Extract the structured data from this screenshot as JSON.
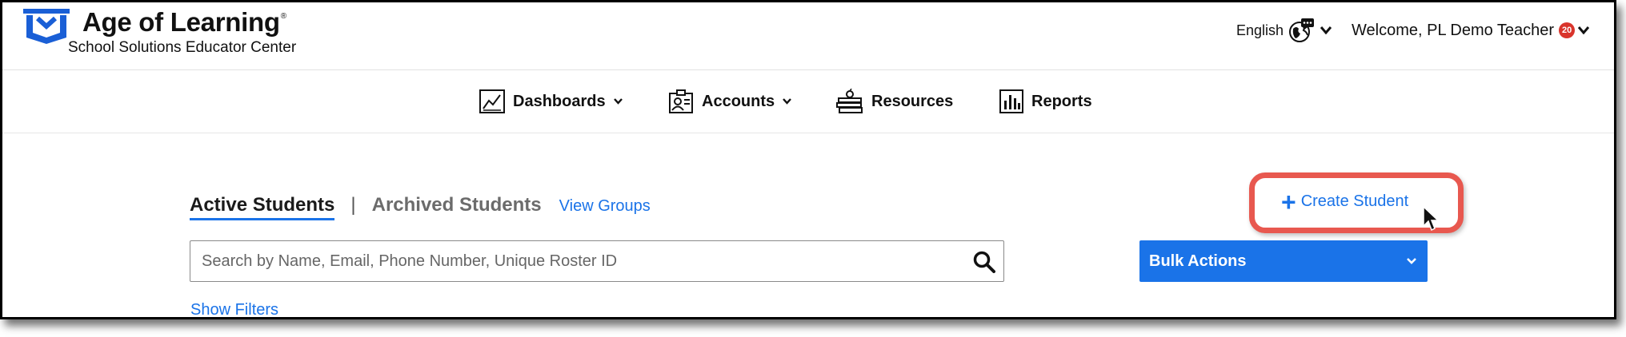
{
  "header": {
    "brand_title": "Age of Learning",
    "brand_mark": "®",
    "brand_subtitle": "School Solutions Educator Center",
    "language_label": "English",
    "welcome_text": "Welcome, PL Demo Teacher",
    "notification_count": "20"
  },
  "nav": {
    "items": [
      {
        "label": "Dashboards",
        "icon": "line-chart-icon",
        "has_dropdown": true
      },
      {
        "label": "Accounts",
        "icon": "id-badge-icon",
        "has_dropdown": true
      },
      {
        "label": "Resources",
        "icon": "books-apple-icon",
        "has_dropdown": false
      },
      {
        "label": "Reports",
        "icon": "bar-chart-icon",
        "has_dropdown": false
      }
    ]
  },
  "students": {
    "tab_active": "Active Students",
    "tab_separator": "|",
    "tab_archived": "Archived Students",
    "view_groups": "View Groups",
    "create_student_label": "Create Student",
    "create_student_icon": "+",
    "search_placeholder": "Search by Name, Email, Phone Number, Unique Roster ID",
    "bulk_actions_label": "Bulk Actions",
    "show_filters": "Show Filters"
  },
  "colors": {
    "accent_blue": "#1a73e8",
    "highlight_red": "#e8584f",
    "badge_red": "#d9342b",
    "logo_blue": "#1a5fd6"
  }
}
